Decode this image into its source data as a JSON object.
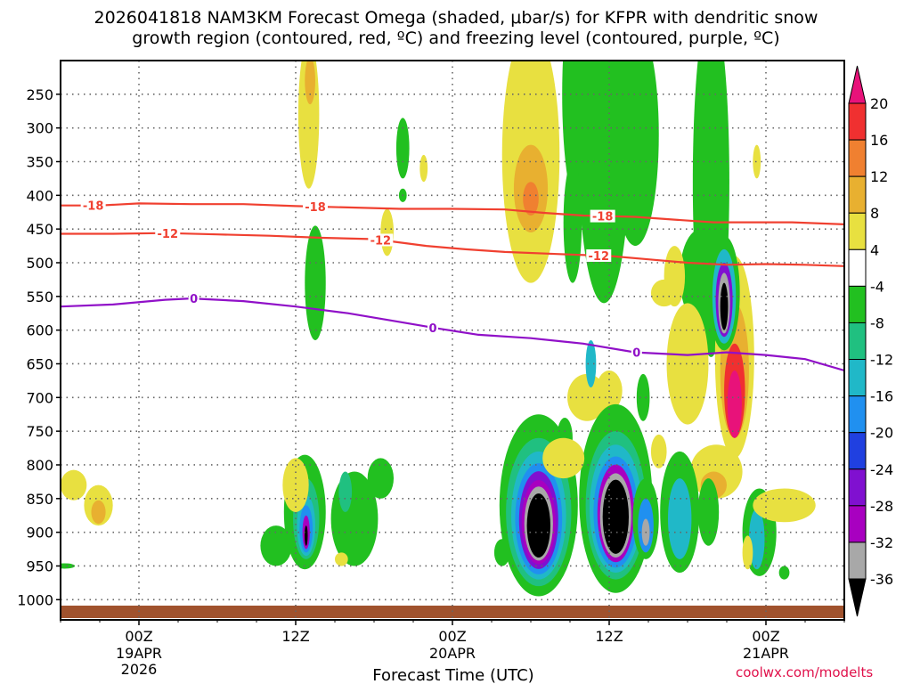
{
  "title": {
    "line1": "2026041818 NAM3KM Forecast Omega (shaded, μbar/s) for KFPR with dendritic snow",
    "line2": "growth region (contoured, red, ºC) and freezing level (contoured, purple, ºC)"
  },
  "credit": "coolwx.com/modelts",
  "chart_data": {
    "type": "heatmap",
    "xlabel": "Forecast Time (UTC)",
    "ylabel": "",
    "x_ticks": [
      {
        "label": "00Z",
        "sub": [
          "19APR",
          "2026"
        ],
        "hour": 6
      },
      {
        "label": "12Z",
        "sub": [],
        "hour": 18
      },
      {
        "label": "00Z",
        "sub": [
          "20APR"
        ],
        "hour": 30
      },
      {
        "label": "12Z",
        "sub": [],
        "hour": 42
      },
      {
        "label": "00Z",
        "sub": [
          "21APR"
        ],
        "hour": 54
      }
    ],
    "xlim_hours": [
      0,
      60
    ],
    "y_ticks": [
      250,
      300,
      350,
      400,
      450,
      500,
      550,
      600,
      650,
      700,
      750,
      800,
      850,
      900,
      950,
      1000
    ],
    "ylim_mb": [
      200,
      1030
    ],
    "colorbar": {
      "levels": [
        "20",
        "16",
        "12",
        "8",
        "4",
        "-4",
        "-8",
        "-12",
        "-16",
        "-20",
        "-24",
        "-28",
        "-32",
        "-36"
      ],
      "colors": [
        "#e8127a",
        "#f03030",
        "#f08030",
        "#e8b030",
        "#e8e040",
        "#ffffff",
        "#22c020",
        "#20c080",
        "#20b8c8",
        "#2090f0",
        "#2040e0",
        "#8010d0",
        "#a800c0",
        "#a8a8a8",
        "#000000"
      ]
    },
    "contours": [
      {
        "name": "dgz-minus18",
        "label": "-18",
        "color": "#f04030",
        "points": [
          [
            0,
            415
          ],
          [
            3,
            415
          ],
          [
            6,
            412
          ],
          [
            10,
            413
          ],
          [
            14,
            413
          ],
          [
            18,
            416
          ],
          [
            22,
            418
          ],
          [
            26,
            420
          ],
          [
            30,
            420
          ],
          [
            34,
            421
          ],
          [
            37,
            426
          ],
          [
            40,
            430
          ],
          [
            44,
            432
          ],
          [
            47,
            436
          ],
          [
            50,
            440
          ],
          [
            53,
            440
          ],
          [
            56,
            440
          ],
          [
            60,
            443
          ]
        ],
        "labels_at": [
          2.5,
          19.5,
          41.5
        ]
      },
      {
        "name": "dgz-minus12",
        "label": "-12",
        "color": "#f04030",
        "points": [
          [
            0,
            457
          ],
          [
            4,
            457
          ],
          [
            8,
            456
          ],
          [
            12,
            458
          ],
          [
            16,
            460
          ],
          [
            20,
            463
          ],
          [
            24,
            465
          ],
          [
            28,
            475
          ],
          [
            31,
            480
          ],
          [
            34,
            484
          ],
          [
            38,
            487
          ],
          [
            42,
            490
          ],
          [
            45,
            495
          ],
          [
            48,
            500
          ],
          [
            51,
            503
          ],
          [
            54,
            502
          ],
          [
            57,
            503
          ],
          [
            60,
            505
          ]
        ],
        "labels_at": [
          8.2,
          24.5,
          41.2
        ]
      },
      {
        "name": "freezing-level",
        "label": "0",
        "color": "#9010c8",
        "points": [
          [
            0,
            565
          ],
          [
            4,
            562
          ],
          [
            8,
            555
          ],
          [
            10,
            553
          ],
          [
            14,
            557
          ],
          [
            18,
            565
          ],
          [
            22,
            575
          ],
          [
            26,
            588
          ],
          [
            29,
            598
          ],
          [
            32,
            607
          ],
          [
            36,
            612
          ],
          [
            40,
            620
          ],
          [
            44,
            633
          ],
          [
            48,
            637
          ],
          [
            51,
            633
          ],
          [
            54,
            637
          ],
          [
            57,
            643
          ],
          [
            60,
            660
          ]
        ],
        "labels_at": [
          10.2,
          28.5,
          44.1
        ]
      }
    ],
    "omega_cells": [
      {
        "x": 1.0,
        "p": 830,
        "w": 1.0,
        "h": 45,
        "level": "4"
      },
      {
        "x": 2.9,
        "p": 860,
        "w": 1.1,
        "h": 60,
        "level": "4"
      },
      {
        "x": 2.9,
        "p": 870,
        "w": 0.55,
        "h": 35,
        "level": "8"
      },
      {
        "x": 0.3,
        "p": 950,
        "w": 0.8,
        "h": 8,
        "level": "-4"
      },
      {
        "x": 19.0,
        "p": 280,
        "w": 0.8,
        "h": 220,
        "level": "4"
      },
      {
        "x": 19.1,
        "p": 230,
        "w": 0.4,
        "h": 70,
        "level": "8"
      },
      {
        "x": 26.2,
        "p": 330,
        "w": 0.5,
        "h": 90,
        "level": "-4"
      },
      {
        "x": 26.2,
        "p": 400,
        "w": 0.3,
        "h": 20,
        "level": "-4"
      },
      {
        "x": 27.8,
        "p": 360,
        "w": 0.3,
        "h": 40,
        "level": "4"
      },
      {
        "x": 19.5,
        "p": 530,
        "w": 0.8,
        "h": 170,
        "level": "-4"
      },
      {
        "x": 25.0,
        "p": 455,
        "w": 0.5,
        "h": 70,
        "level": "4"
      },
      {
        "x": 36.0,
        "p": 340,
        "w": 2.2,
        "h": 380,
        "level": "4"
      },
      {
        "x": 36.0,
        "p": 390,
        "w": 1.3,
        "h": 130,
        "level": "8"
      },
      {
        "x": 36.0,
        "p": 405,
        "w": 0.6,
        "h": 50,
        "level": "12"
      },
      {
        "x": 39.8,
        "p": 250,
        "w": 1.4,
        "h": 350,
        "level": "-4"
      },
      {
        "x": 41.6,
        "p": 320,
        "w": 2.0,
        "h": 480,
        "level": "-4"
      },
      {
        "x": 44.0,
        "p": 310,
        "w": 1.8,
        "h": 330,
        "level": "-4"
      },
      {
        "x": 49.8,
        "p": 380,
        "w": 1.4,
        "h": 520,
        "level": "-4"
      },
      {
        "x": 49.0,
        "p": 520,
        "w": 1.6,
        "h": 140,
        "level": "-4"
      },
      {
        "x": 39.2,
        "p": 440,
        "w": 0.7,
        "h": 180,
        "level": "-4"
      },
      {
        "x": 47.0,
        "p": 520,
        "w": 0.8,
        "h": 90,
        "level": "4"
      },
      {
        "x": 46.2,
        "p": 545,
        "w": 1.0,
        "h": 40,
        "level": "4"
      },
      {
        "x": 53.3,
        "p": 350,
        "w": 0.3,
        "h": 50,
        "level": "4"
      },
      {
        "x": 48.0,
        "p": 650,
        "w": 1.6,
        "h": 180,
        "level": "4"
      },
      {
        "x": 40.3,
        "p": 700,
        "w": 1.5,
        "h": 70,
        "level": "4"
      },
      {
        "x": 42.0,
        "p": 690,
        "w": 1.0,
        "h": 60,
        "level": "4"
      },
      {
        "x": 51.6,
        "p": 640,
        "w": 1.5,
        "h": 300,
        "level": "4"
      },
      {
        "x": 51.6,
        "p": 660,
        "w": 1.1,
        "h": 200,
        "level": "8"
      },
      {
        "x": 51.6,
        "p": 690,
        "w": 0.8,
        "h": 140,
        "level": "16"
      },
      {
        "x": 51.6,
        "p": 710,
        "w": 0.55,
        "h": 100,
        "level": "20"
      },
      {
        "x": 50.2,
        "p": 810,
        "w": 2.0,
        "h": 80,
        "level": "4"
      },
      {
        "x": 50.0,
        "p": 830,
        "w": 1.0,
        "h": 40,
        "level": "8"
      },
      {
        "x": 18.7,
        "p": 870,
        "w": 1.6,
        "h": 170,
        "level": "-4"
      },
      {
        "x": 18.8,
        "p": 880,
        "w": 1.0,
        "h": 120,
        "level": "-8"
      },
      {
        "x": 18.8,
        "p": 890,
        "w": 0.7,
        "h": 90,
        "level": "-12"
      },
      {
        "x": 18.8,
        "p": 895,
        "w": 0.5,
        "h": 70,
        "level": "-16"
      },
      {
        "x": 18.8,
        "p": 900,
        "w": 0.28,
        "h": 50,
        "level": "-28"
      },
      {
        "x": 18.8,
        "p": 905,
        "w": 0.12,
        "h": 30,
        "level": "-36"
      },
      {
        "x": 16.5,
        "p": 920,
        "w": 1.2,
        "h": 60,
        "level": "-4"
      },
      {
        "x": 18.0,
        "p": 830,
        "w": 1.0,
        "h": 80,
        "level": "4"
      },
      {
        "x": 22.5,
        "p": 880,
        "w": 1.8,
        "h": 140,
        "level": "-4"
      },
      {
        "x": 21.8,
        "p": 840,
        "w": 0.5,
        "h": 60,
        "level": "-8"
      },
      {
        "x": 21.5,
        "p": 940,
        "w": 0.5,
        "h": 20,
        "level": "4"
      },
      {
        "x": 24.5,
        "p": 820,
        "w": 1.0,
        "h": 60,
        "level": "-4"
      },
      {
        "x": 36.6,
        "p": 860,
        "w": 3.0,
        "h": 270,
        "level": "-4"
      },
      {
        "x": 36.6,
        "p": 870,
        "w": 2.5,
        "h": 220,
        "level": "-8"
      },
      {
        "x": 36.6,
        "p": 875,
        "w": 2.1,
        "h": 190,
        "level": "-12"
      },
      {
        "x": 36.6,
        "p": 880,
        "w": 1.8,
        "h": 165,
        "level": "-16"
      },
      {
        "x": 36.6,
        "p": 882,
        "w": 1.5,
        "h": 145,
        "level": "-24"
      },
      {
        "x": 36.6,
        "p": 885,
        "w": 1.3,
        "h": 125,
        "level": "-28"
      },
      {
        "x": 36.6,
        "p": 887,
        "w": 1.1,
        "h": 110,
        "level": "-32"
      },
      {
        "x": 36.6,
        "p": 890,
        "w": 0.9,
        "h": 95,
        "level": "-36"
      },
      {
        "x": 33.8,
        "p": 930,
        "w": 0.6,
        "h": 40,
        "level": "-4"
      },
      {
        "x": 38.6,
        "p": 760,
        "w": 0.6,
        "h": 60,
        "level": "-4"
      },
      {
        "x": 42.5,
        "p": 850,
        "w": 2.8,
        "h": 280,
        "level": "-4"
      },
      {
        "x": 42.5,
        "p": 860,
        "w": 2.3,
        "h": 220,
        "level": "-8"
      },
      {
        "x": 42.5,
        "p": 865,
        "w": 2.0,
        "h": 190,
        "level": "-12"
      },
      {
        "x": 42.5,
        "p": 870,
        "w": 1.7,
        "h": 165,
        "level": "-16"
      },
      {
        "x": 42.5,
        "p": 872,
        "w": 1.4,
        "h": 145,
        "level": "-28"
      },
      {
        "x": 42.5,
        "p": 875,
        "w": 1.2,
        "h": 125,
        "level": "-32"
      },
      {
        "x": 42.5,
        "p": 877,
        "w": 1.0,
        "h": 110,
        "level": "-36"
      },
      {
        "x": 44.8,
        "p": 880,
        "w": 1.0,
        "h": 120,
        "level": "-4"
      },
      {
        "x": 44.8,
        "p": 890,
        "w": 0.6,
        "h": 80,
        "level": "-16"
      },
      {
        "x": 44.8,
        "p": 900,
        "w": 0.3,
        "h": 40,
        "level": "-32"
      },
      {
        "x": 44.6,
        "p": 700,
        "w": 0.5,
        "h": 70,
        "level": "-4"
      },
      {
        "x": 47.4,
        "p": 870,
        "w": 1.5,
        "h": 180,
        "level": "-4"
      },
      {
        "x": 47.4,
        "p": 880,
        "w": 0.9,
        "h": 120,
        "level": "-12"
      },
      {
        "x": 45.8,
        "p": 780,
        "w": 0.6,
        "h": 50,
        "level": "4"
      },
      {
        "x": 49.6,
        "p": 870,
        "w": 0.8,
        "h": 100,
        "level": "-4"
      },
      {
        "x": 50.8,
        "p": 545,
        "w": 1.2,
        "h": 170,
        "level": "-4"
      },
      {
        "x": 50.8,
        "p": 550,
        "w": 0.9,
        "h": 140,
        "level": "-12"
      },
      {
        "x": 50.8,
        "p": 555,
        "w": 0.65,
        "h": 110,
        "level": "-24"
      },
      {
        "x": 50.8,
        "p": 560,
        "w": 0.45,
        "h": 90,
        "level": "-32"
      },
      {
        "x": 50.8,
        "p": 565,
        "w": 0.3,
        "h": 70,
        "level": "-36"
      },
      {
        "x": 40.6,
        "p": 650,
        "w": 0.4,
        "h": 70,
        "level": "-12"
      },
      {
        "x": 53.5,
        "p": 900,
        "w": 1.3,
        "h": 130,
        "level": "-4"
      },
      {
        "x": 53.3,
        "p": 910,
        "w": 0.6,
        "h": 90,
        "level": "-12"
      },
      {
        "x": 52.6,
        "p": 930,
        "w": 0.4,
        "h": 50,
        "level": "4"
      },
      {
        "x": 55.4,
        "p": 860,
        "w": 2.4,
        "h": 50,
        "level": "4"
      },
      {
        "x": 55.4,
        "p": 960,
        "w": 0.4,
        "h": 20,
        "level": "-4"
      },
      {
        "x": 38.5,
        "p": 790,
        "w": 1.6,
        "h": 60,
        "level": "4"
      }
    ]
  }
}
